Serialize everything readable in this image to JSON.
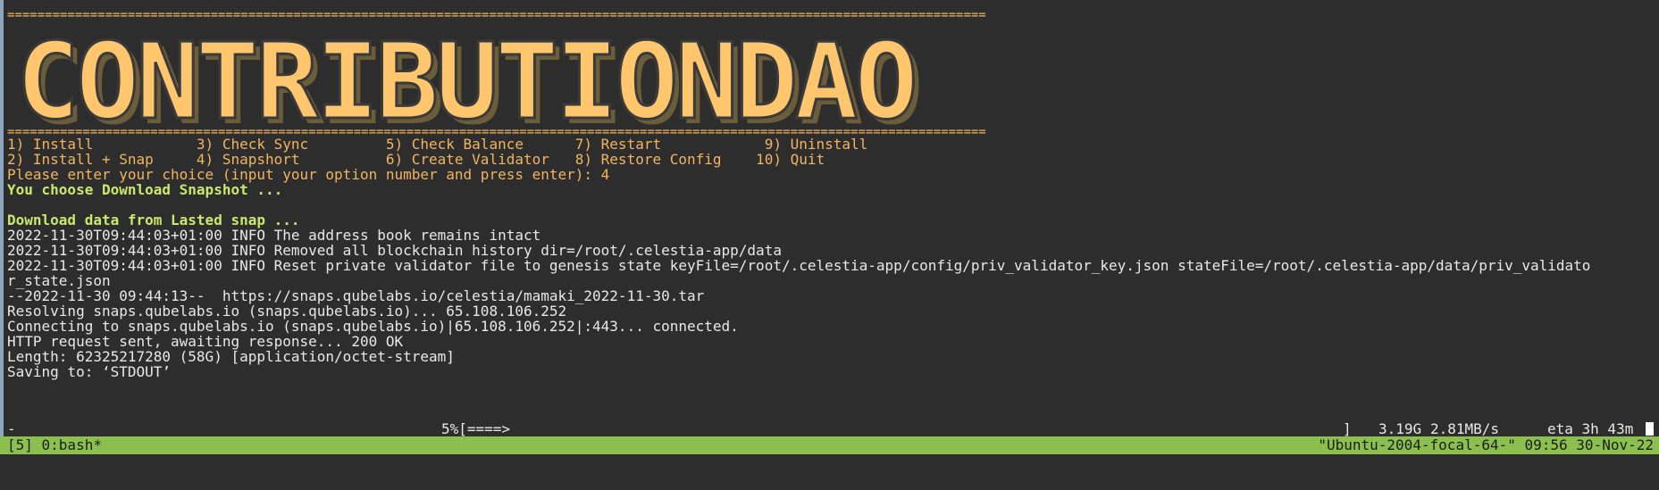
{
  "banner": {
    "text": "CONTRIBUTIONDAO"
  },
  "separator": "==================================================================================================================================",
  "menu": {
    "row1": "1) Install            3) Check Sync         5) Check Balance      7) Restart            9) Uninstall",
    "row2": "2) Install + Snap     4) Snapshort          6) Create Validator   8) Restore Config    10) Quit"
  },
  "prompt": "Please enter your choice (input your option number and press enter): 4",
  "choice": "You choose Download Snapshot ...",
  "download_header": "Download data from Lasted snap ...",
  "log": [
    "2022-11-30T09:44:03+01:00 INFO The address book remains intact",
    "2022-11-30T09:44:03+01:00 INFO Removed all blockchain history dir=/root/.celestia-app/data",
    "2022-11-30T09:44:03+01:00 INFO Reset private validator file to genesis state keyFile=/root/.celestia-app/config/priv_validator_key.json stateFile=/root/.celestia-app/data/priv_validato",
    "r_state.json",
    "--2022-11-30 09:44:13--  https://snaps.qubelabs.io/celestia/mamaki_2022-11-30.tar",
    "Resolving snaps.qubelabs.io (snaps.qubelabs.io)... 65.108.106.252",
    "Connecting to snaps.qubelabs.io (snaps.qubelabs.io)|65.108.106.252|:443... connected.",
    "HTTP request sent, awaiting response... 200 OK",
    "Length: 62325217280 (58G) [application/octet-stream]",
    "Saving to: ‘STDOUT’"
  ],
  "progress": {
    "dash": "-",
    "percent_bar": "5%[====>",
    "close_bracket": "]",
    "downloaded": "3.19G",
    "rate": "2.81MB/s",
    "eta": "eta 3h 43m",
    "fraction": 0.05
  },
  "status": {
    "left": "[5] 0:bash*",
    "right": "\"Ubuntu-2004-focal-64-\" 09:56 30-Nov-22"
  },
  "colors": {
    "background": "#2d2d2d",
    "banner": "#ffc66d",
    "menu_text": "#f2b45f",
    "highlight": "#cbe86b",
    "status_bar": "#8cc04e"
  }
}
